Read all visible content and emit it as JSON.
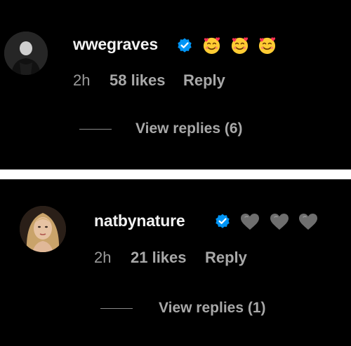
{
  "comments": [
    {
      "username": "wwegraves",
      "verified": true,
      "reaction_emojis": [
        "smiling-face-with-hearts-icon",
        "smiling-face-with-hearts-icon",
        "smiling-face-with-hearts-icon"
      ],
      "time": "2h",
      "likes": "58 likes",
      "reply_label": "Reply",
      "view_replies": "View replies (6)"
    },
    {
      "username": "natbynature",
      "verified": true,
      "reaction_emojis": [
        "grey-heart-icon",
        "grey-heart-icon",
        "grey-heart-icon"
      ],
      "time": "2h",
      "likes": "21 likes",
      "reply_label": "Reply",
      "view_replies": "View replies (1)"
    }
  ],
  "colors": {
    "background": "#000000",
    "separator": "#ffffff",
    "verified_badge": "#0095f6",
    "username_text": "#f2f2f2",
    "meta_text": "#a8a8a8"
  }
}
